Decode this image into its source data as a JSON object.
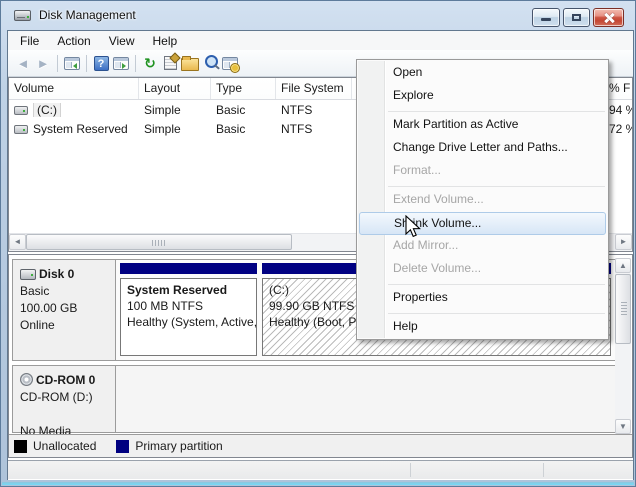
{
  "window": {
    "title": "Disk Management"
  },
  "menubar": {
    "items": [
      "File",
      "Action",
      "View",
      "Help"
    ]
  },
  "toolbar": {
    "icons": [
      "back",
      "forward",
      "show-console-tree",
      "help",
      "show-action-pane",
      "refresh",
      "properties",
      "open-folder",
      "find",
      "services"
    ]
  },
  "volume_list": {
    "columns": [
      "Volume",
      "Layout",
      "Type",
      "File System",
      "% F"
    ],
    "rows": [
      {
        "volume": "(C:)",
        "layout": "Simple",
        "type": "Basic",
        "file_system": "NTFS",
        "pct_free": "94 %",
        "selected": true
      },
      {
        "volume": "System Reserved",
        "layout": "Simple",
        "type": "Basic",
        "file_system": "NTFS",
        "pct_free": "72 %",
        "selected": false
      }
    ]
  },
  "context_menu": {
    "items": [
      {
        "label": "Open",
        "enabled": true
      },
      {
        "label": "Explore",
        "enabled": true
      },
      {
        "label": "Mark Partition as Active",
        "enabled": true
      },
      {
        "label": "Change Drive Letter and Paths...",
        "enabled": true
      },
      {
        "label": "Format...",
        "enabled": false
      },
      {
        "label": "Extend Volume...",
        "enabled": false
      },
      {
        "label": "Shrink Volume...",
        "enabled": true,
        "highlighted": true
      },
      {
        "label": "Add Mirror...",
        "enabled": false
      },
      {
        "label": "Delete Volume...",
        "enabled": false
      },
      {
        "label": "Properties",
        "enabled": true
      },
      {
        "label": "Help",
        "enabled": true
      }
    ]
  },
  "disks": [
    {
      "name": "Disk 0",
      "type": "Basic",
      "size": "100.00 GB",
      "status": "Online",
      "partitions": [
        {
          "name": "System Reserved",
          "size": "100 MB NTFS",
          "status": "Healthy (System, Active,",
          "selected": false
        },
        {
          "name": "(C:)",
          "size": "99.90 GB NTFS",
          "status": "Healthy (Boot, Pa",
          "selected": true
        }
      ]
    },
    {
      "name": "CD-ROM 0",
      "drive": "CD-ROM (D:)",
      "status": "No Media"
    }
  ],
  "legend": {
    "items": [
      {
        "label": "Unallocated",
        "color": "#000000"
      },
      {
        "label": "Primary partition",
        "color": "#000080"
      }
    ]
  },
  "colors": {
    "primary_partition": "#000080",
    "unallocated": "#000000",
    "titlebar": "#bfd2e6",
    "close_button": "#ce5442",
    "menu_highlight": "#d7e6f6"
  }
}
